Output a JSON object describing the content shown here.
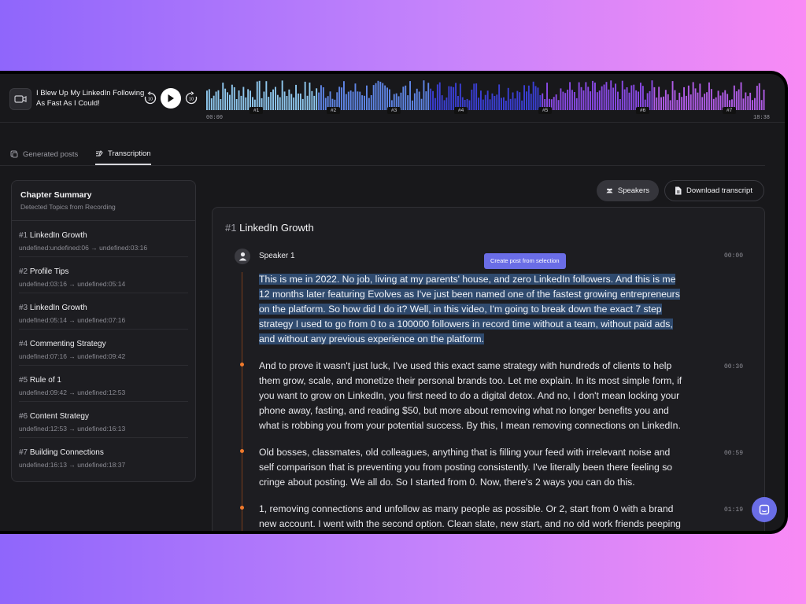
{
  "player": {
    "title": "I Blew Up My LinkedIn Following As Fast As I Could!",
    "rewind_label": "10",
    "forward_label": "10",
    "time_start": "00:00",
    "time_end": "18:38",
    "markers": [
      "#1",
      "#2",
      "#3",
      "#4",
      "#5",
      "#6",
      "#7"
    ],
    "wave_colors": [
      "#8fc8ef",
      "#5f86e6",
      "#3b3fd6",
      "#8a4ae6",
      "#b15ce8"
    ]
  },
  "tabs": [
    {
      "label": "Generated posts",
      "active": false
    },
    {
      "label": "Transcription",
      "active": true
    }
  ],
  "chapters": {
    "title": "Chapter Summary",
    "subtitle": "Detected Topics from Recording",
    "items": [
      {
        "num": "#1",
        "name": "LinkedIn Growth",
        "time": "undefined:undefined:06 → undefined:03:16"
      },
      {
        "num": "#2",
        "name": "Profile Tips",
        "time": "undefined:03:16 → undefined:05:14"
      },
      {
        "num": "#3",
        "name": "LinkedIn Growth",
        "time": "undefined:05:14 → undefined:07:16"
      },
      {
        "num": "#4",
        "name": "Commenting Strategy",
        "time": "undefined:07:16 → undefined:09:42"
      },
      {
        "num": "#5",
        "name": "Rule of 1",
        "time": "undefined:09:42 → undefined:12:53"
      },
      {
        "num": "#6",
        "name": "Content Strategy",
        "time": "undefined:12:53 → undefined:16:13"
      },
      {
        "num": "#7",
        "name": "Building Connections",
        "time": "undefined:16:13 → undefined:18:37"
      }
    ]
  },
  "actions": {
    "speakers_label": "Speakers",
    "download_label": "Download transcript"
  },
  "transcript": {
    "chapter_num": "#1",
    "chapter_title": "LinkedIn Growth",
    "speaker": "Speaker 1",
    "tooltip": "Create post from selection",
    "paragraphs": [
      {
        "time": "00:00",
        "selected": true,
        "lines": [
          "This is me in 2022. No job, living at my parents' house, and zero LinkedIn followers. And this is me",
          "12 months later featuring Evolves as I've just been named one of the fastest growing entrepreneurs",
          "on the platform. So how did I do it? Well, in this video, I'm going to break down the exact 7 step",
          "strategy I used to go from 0 to a 100000 followers in record time without a team, without paid ads,",
          "and without any previous experience on the platform."
        ]
      },
      {
        "time": "00:30",
        "selected": false,
        "lines": [
          "And to prove it wasn't just luck, I've used this exact same strategy with hundreds of clients to help",
          "them grow, scale, and monetize their personal brands too. Let me explain. In its most simple form, if",
          "you want to grow on LinkedIn, you first need to do a digital detox. And no, I don't mean locking your",
          "phone away, fasting, and reading $50, but more about removing what no longer benefits you and",
          "what is robbing you from your potential success. By this, I mean removing connections on LinkedIn."
        ]
      },
      {
        "time": "00:59",
        "selected": false,
        "lines": [
          "Old bosses, classmates, old colleagues, anything that is filling your feed with irrelevant noise and",
          "self comparison that is preventing you from posting consistently. I've literally been there feeling so",
          "cringe about posting. We all do. So I started from 0. Now, there's 2 ways you can do this."
        ]
      },
      {
        "time": "01:19",
        "selected": false,
        "lines": [
          "1, removing connections and unfollow as many people as possible. Or 2, start from 0 with a brand",
          "new account. I went with the second option. Clean slate, new start, and no old work friends peeping"
        ]
      }
    ]
  },
  "colors": {
    "accent": "#6a6de6",
    "timeline": "#f07a2c",
    "selection": "#2f4a6e"
  }
}
